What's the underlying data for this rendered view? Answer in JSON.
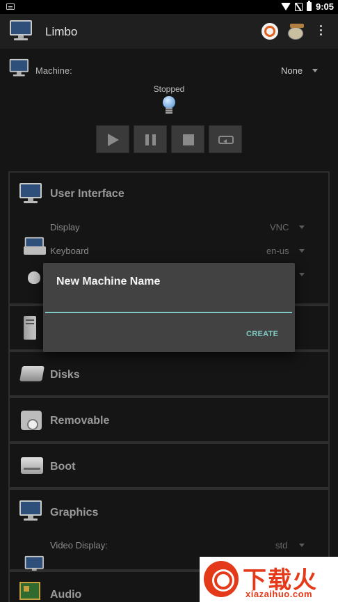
{
  "status_bar": {
    "time": "9:05"
  },
  "app_bar": {
    "title": "Limbo"
  },
  "machine": {
    "label": "Machine:",
    "selected": "None"
  },
  "vm_status": "Stopped",
  "sections": {
    "user_interface": {
      "title": "User Interface",
      "display": {
        "label": "Display",
        "value": "VNC"
      },
      "keyboard": {
        "label": "Keyboard",
        "value": "en-us"
      }
    },
    "disks": {
      "title": "Disks"
    },
    "removable": {
      "title": "Removable"
    },
    "boot": {
      "title": "Boot"
    },
    "graphics": {
      "title": "Graphics",
      "video_display": {
        "label": "Video Display:",
        "value": "std"
      }
    },
    "audio": {
      "title": "Audio"
    }
  },
  "dialog": {
    "title": "New Machine Name",
    "input_value": "",
    "create_label": "CREATE"
  },
  "watermark": {
    "brand": "下载火",
    "url": "xiazaihuo.com"
  },
  "colors": {
    "accent": "#7fcbc4",
    "background": "#151515",
    "dialog": "#424242",
    "watermark": "#e43a1a"
  }
}
